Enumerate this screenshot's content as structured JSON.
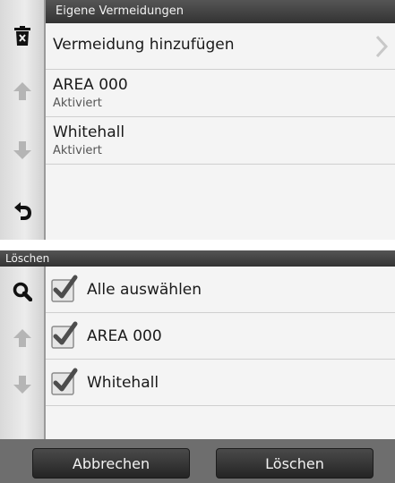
{
  "screen1": {
    "header_title": "Eigene Vermeidungen",
    "add_item": {
      "label": "Vermeidung hinzufügen"
    },
    "items": [
      {
        "name": "AREA 000",
        "status": "Aktiviert"
      },
      {
        "name": "Whitehall",
        "status": "Aktiviert"
      }
    ],
    "sidebar_icons": [
      "trash-icon",
      "arrow-up-icon",
      "arrow-down-icon",
      "back-icon"
    ]
  },
  "screen2": {
    "header_title": "Löschen",
    "select_all_label": "Alle auswählen",
    "items": [
      {
        "name": "AREA 000",
        "checked": true
      },
      {
        "name": "Whitehall",
        "checked": true
      }
    ],
    "sidebar_icons": [
      "search-icon",
      "arrow-up-icon",
      "arrow-down-icon"
    ],
    "cancel_label": "Abbrechen",
    "delete_label": "Löschen"
  },
  "colors": {
    "header_bg": "#3b3b3b",
    "list_bg": "#f4f4f4",
    "footer_bg": "#6e6e6e",
    "button_bg": "#2e2e2e",
    "arrow_disabled": "#b5b5b5"
  }
}
